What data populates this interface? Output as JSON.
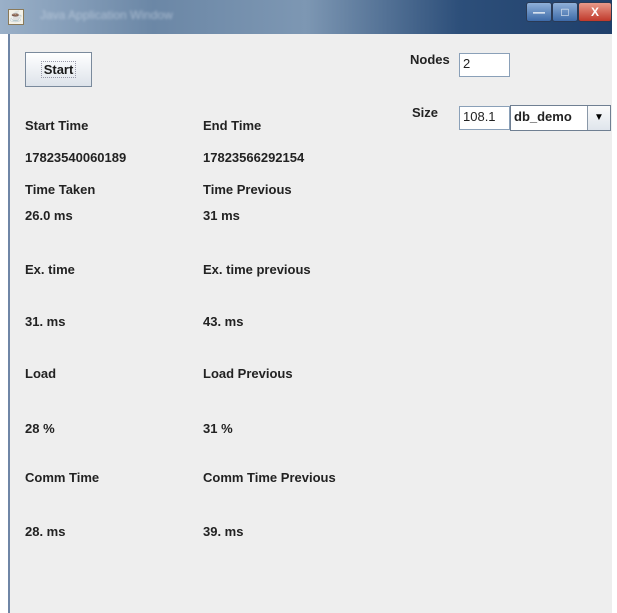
{
  "window": {
    "title": "Java Application Window",
    "buttons": {
      "minimize": "—",
      "maximize": "□",
      "close": "X"
    }
  },
  "controls": {
    "start_label": "Start",
    "nodes_label": "Nodes",
    "nodes_value": "2",
    "size_label": "Size",
    "size_value": "108.1",
    "db_selected": "db_demo",
    "db_arrow": "▼"
  },
  "stats": {
    "start_time_label": "Start Time",
    "start_time_value": "17823540060189",
    "end_time_label": "End Time",
    "end_time_value": "17823566292154",
    "time_taken_label": "Time Taken",
    "time_taken_value": "26.0 ms",
    "time_previous_label": "Time Previous",
    "time_previous_value": "31 ms",
    "ex_time_label": "Ex. time",
    "ex_time_value": "31. ms",
    "ex_time_previous_label": "Ex. time previous",
    "ex_time_previous_value": "43. ms",
    "load_label": "Load",
    "load_value": "28 %",
    "load_previous_label": "Load Previous",
    "load_previous_value": "31 %",
    "comm_time_label": "Comm Time",
    "comm_time_value": "28. ms",
    "comm_time_previous_label": "Comm Time Previous",
    "comm_time_previous_value": "39. ms"
  }
}
